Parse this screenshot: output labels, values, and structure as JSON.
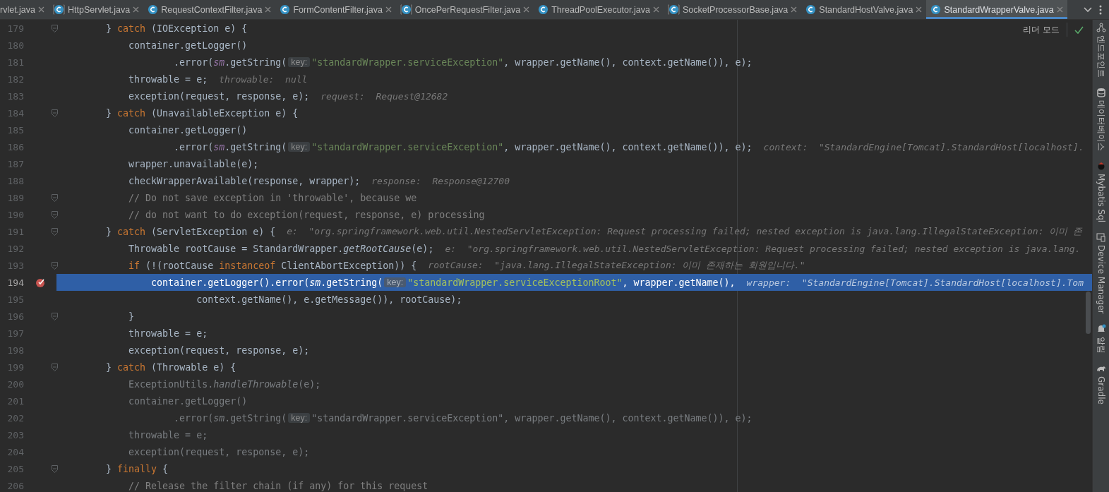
{
  "tabs": [
    {
      "label": "rvlet.java",
      "kind": "clipped",
      "selected": false
    },
    {
      "label": "HttpServlet.java",
      "kind": "library",
      "selected": false
    },
    {
      "label": "RequestContextFilter.java",
      "kind": "class",
      "selected": false
    },
    {
      "label": "FormContentFilter.java",
      "kind": "class",
      "selected": false
    },
    {
      "label": "OncePerRequestFilter.java",
      "kind": "library",
      "selected": false
    },
    {
      "label": "ThreadPoolExecutor.java",
      "kind": "class",
      "selected": false
    },
    {
      "label": "SocketProcessorBase.java",
      "kind": "library",
      "selected": false
    },
    {
      "label": "StandardHostValve.java",
      "kind": "class",
      "selected": false
    },
    {
      "label": "StandardWrapperValve.java",
      "kind": "class",
      "selected": true
    }
  ],
  "reader_mode": {
    "label": "리더 모드"
  },
  "lines": [
    {
      "number": "179",
      "fold": true,
      "breakpoint": false,
      "selected": false,
      "tokens": [
        {
          "kind": "plain",
          "text": "        } "
        },
        {
          "kind": "kw",
          "text": "catch"
        },
        {
          "kind": "plain",
          "text": " (IOException e) {"
        }
      ]
    },
    {
      "number": "180",
      "fold": false,
      "breakpoint": false,
      "selected": false,
      "tokens": [
        {
          "kind": "plain",
          "text": "            container.getLogger()"
        }
      ]
    },
    {
      "number": "181",
      "fold": false,
      "breakpoint": false,
      "selected": false,
      "tokens": [
        {
          "kind": "plain",
          "text": "                    .error("
        },
        {
          "kind": "field",
          "text": "sm"
        },
        {
          "kind": "plain",
          "text": ".getString("
        },
        {
          "kind": "hint",
          "text": "key:"
        },
        {
          "kind": "str",
          "text": "\"standardWrapper.serviceException\""
        },
        {
          "kind": "plain",
          "text": ", wrapper.getName(), context.getName()), e);"
        }
      ]
    },
    {
      "number": "182",
      "fold": false,
      "breakpoint": false,
      "selected": false,
      "tokens": [
        {
          "kind": "plain",
          "text": "            throwable = e;"
        },
        {
          "kind": "debug",
          "text": "throwable:  null"
        }
      ]
    },
    {
      "number": "183",
      "fold": false,
      "breakpoint": false,
      "selected": false,
      "tokens": [
        {
          "kind": "plain",
          "text": "            exception(request, response, e);"
        },
        {
          "kind": "debug",
          "text": "request:  Request@12682"
        }
      ]
    },
    {
      "number": "184",
      "fold": true,
      "breakpoint": false,
      "selected": false,
      "tokens": [
        {
          "kind": "plain",
          "text": "        } "
        },
        {
          "kind": "kw",
          "text": "catch"
        },
        {
          "kind": "plain",
          "text": " (UnavailableException e) {"
        }
      ]
    },
    {
      "number": "185",
      "fold": false,
      "breakpoint": false,
      "selected": false,
      "tokens": [
        {
          "kind": "plain",
          "text": "            container.getLogger()"
        }
      ]
    },
    {
      "number": "186",
      "fold": false,
      "breakpoint": false,
      "selected": false,
      "tokens": [
        {
          "kind": "plain",
          "text": "                    .error("
        },
        {
          "kind": "field",
          "text": "sm"
        },
        {
          "kind": "plain",
          "text": ".getString("
        },
        {
          "kind": "hint",
          "text": "key:"
        },
        {
          "kind": "str",
          "text": "\"standardWrapper.serviceException\""
        },
        {
          "kind": "plain",
          "text": ", wrapper.getName(), context.getName()), e);"
        },
        {
          "kind": "debug",
          "text": "context:  \"StandardEngine[Tomcat].StandardHost[localhost]."
        }
      ]
    },
    {
      "number": "187",
      "fold": false,
      "breakpoint": false,
      "selected": false,
      "tokens": [
        {
          "kind": "plain",
          "text": "            wrapper.unavailable(e);"
        }
      ]
    },
    {
      "number": "188",
      "fold": false,
      "breakpoint": false,
      "selected": false,
      "tokens": [
        {
          "kind": "plain",
          "text": "            checkWrapperAvailable(response, wrapper);"
        },
        {
          "kind": "debug",
          "text": "response:  Response@12700"
        }
      ]
    },
    {
      "number": "189",
      "fold": true,
      "breakpoint": false,
      "selected": false,
      "tokens": [
        {
          "kind": "comment",
          "text": "            // Do not save exception in 'throwable', because we"
        }
      ]
    },
    {
      "number": "190",
      "fold": true,
      "breakpoint": false,
      "selected": false,
      "tokens": [
        {
          "kind": "comment",
          "text": "            // do not want to do exception(request, response, e) processing"
        }
      ]
    },
    {
      "number": "191",
      "fold": true,
      "breakpoint": false,
      "selected": false,
      "tokens": [
        {
          "kind": "plain",
          "text": "        } "
        },
        {
          "kind": "kw",
          "text": "catch"
        },
        {
          "kind": "plain",
          "text": " (ServletException e) {"
        },
        {
          "kind": "debug",
          "text": "e:  \"org.springframework.web.util.NestedServletException: Request processing failed; nested exception is java.lang.IllegalStateException: 이미 존"
        }
      ]
    },
    {
      "number": "192",
      "fold": false,
      "breakpoint": false,
      "selected": false,
      "tokens": [
        {
          "kind": "plain",
          "text": "            Throwable rootCause = StandardWrapper."
        },
        {
          "kind": "italic",
          "text": "getRootCause"
        },
        {
          "kind": "plain",
          "text": "(e);"
        },
        {
          "kind": "debug",
          "text": "e:  \"org.springframework.web.util.NestedServletException: Request processing failed; nested exception is java.lang."
        }
      ]
    },
    {
      "number": "193",
      "fold": true,
      "breakpoint": false,
      "selected": false,
      "tokens": [
        {
          "kind": "kw",
          "text": "            if"
        },
        {
          "kind": "plain",
          "text": " (!(rootCause "
        },
        {
          "kind": "kw",
          "text": "instanceof"
        },
        {
          "kind": "plain",
          "text": " ClientAbortException)) {"
        },
        {
          "kind": "debug",
          "text": "rootCause:  \"java.lang.IllegalStateException: 이미 존재하는 회원입니다.\""
        }
      ]
    },
    {
      "number": "194",
      "fold": false,
      "breakpoint": true,
      "selected": true,
      "tokens": [
        {
          "kind": "plain",
          "text": "                container.getLogger().error("
        },
        {
          "kind": "field",
          "text": "sm"
        },
        {
          "kind": "plain",
          "text": ".getString("
        },
        {
          "kind": "hint",
          "text": "key:"
        },
        {
          "kind": "str",
          "text": "\"standardWrapper.serviceExceptionRoot\""
        },
        {
          "kind": "plain",
          "text": ", wrapper.getName(),"
        },
        {
          "kind": "debug",
          "text": "wrapper:  \"StandardEngine[Tomcat].StandardHost[localhost].Tom"
        }
      ]
    },
    {
      "number": "195",
      "fold": false,
      "breakpoint": false,
      "selected": false,
      "tokens": [
        {
          "kind": "plain",
          "text": "                        context.getName(), e.getMessage()), rootCause);"
        }
      ]
    },
    {
      "number": "196",
      "fold": true,
      "breakpoint": false,
      "selected": false,
      "tokens": [
        {
          "kind": "plain",
          "text": "            }"
        }
      ]
    },
    {
      "number": "197",
      "fold": false,
      "breakpoint": false,
      "selected": false,
      "tokens": [
        {
          "kind": "plain",
          "text": "            throwable = e;"
        }
      ]
    },
    {
      "number": "198",
      "fold": false,
      "breakpoint": false,
      "selected": false,
      "tokens": [
        {
          "kind": "plain",
          "text": "            exception(request, response, e);"
        }
      ]
    },
    {
      "number": "199",
      "fold": true,
      "breakpoint": false,
      "selected": false,
      "tokens": [
        {
          "kind": "plain",
          "text": "        } "
        },
        {
          "kind": "kw",
          "text": "catch"
        },
        {
          "kind": "plain",
          "text": " (Throwable e) {"
        }
      ]
    },
    {
      "number": "200",
      "fold": false,
      "breakpoint": false,
      "selected": false,
      "tokens": [
        {
          "kind": "muted",
          "text": "            ExceptionUtils."
        },
        {
          "kind": "muted-italic",
          "text": "handleThrowable"
        },
        {
          "kind": "muted",
          "text": "(e);"
        }
      ]
    },
    {
      "number": "201",
      "fold": false,
      "breakpoint": false,
      "selected": false,
      "tokens": [
        {
          "kind": "muted",
          "text": "            container.getLogger()"
        }
      ]
    },
    {
      "number": "202",
      "fold": false,
      "breakpoint": false,
      "selected": false,
      "tokens": [
        {
          "kind": "muted",
          "text": "                    .error("
        },
        {
          "kind": "muted-italic",
          "text": "sm"
        },
        {
          "kind": "muted",
          "text": ".getString("
        },
        {
          "kind": "hint",
          "text": "key:"
        },
        {
          "kind": "muted",
          "text": "\"standardWrapper.serviceException\", wrapper.getName(), context.getName()), e);"
        }
      ]
    },
    {
      "number": "203",
      "fold": false,
      "breakpoint": false,
      "selected": false,
      "tokens": [
        {
          "kind": "muted",
          "text": "            throwable = e;"
        }
      ]
    },
    {
      "number": "204",
      "fold": false,
      "breakpoint": false,
      "selected": false,
      "tokens": [
        {
          "kind": "muted",
          "text": "            exception(request, response, e);"
        }
      ]
    },
    {
      "number": "205",
      "fold": true,
      "breakpoint": false,
      "selected": false,
      "tokens": [
        {
          "kind": "plain",
          "text": "        } "
        },
        {
          "kind": "kw",
          "text": "finally"
        },
        {
          "kind": "plain",
          "text": " {"
        }
      ]
    },
    {
      "number": "206",
      "fold": false,
      "breakpoint": false,
      "selected": false,
      "tokens": [
        {
          "kind": "comment",
          "text": "            // Release the filter chain (if any) for this request"
        }
      ]
    }
  ],
  "tool_windows": [
    {
      "label": "엔드포인트",
      "kind": "endpoints"
    },
    {
      "label": "데이터베이스",
      "kind": "database"
    },
    {
      "label": "Mybatis Sql",
      "kind": "mybatis"
    },
    {
      "label": "Device Manager",
      "kind": "device"
    },
    {
      "label": "알림",
      "kind": "notifications"
    },
    {
      "label": "Gradle",
      "kind": "gradle"
    }
  ]
}
